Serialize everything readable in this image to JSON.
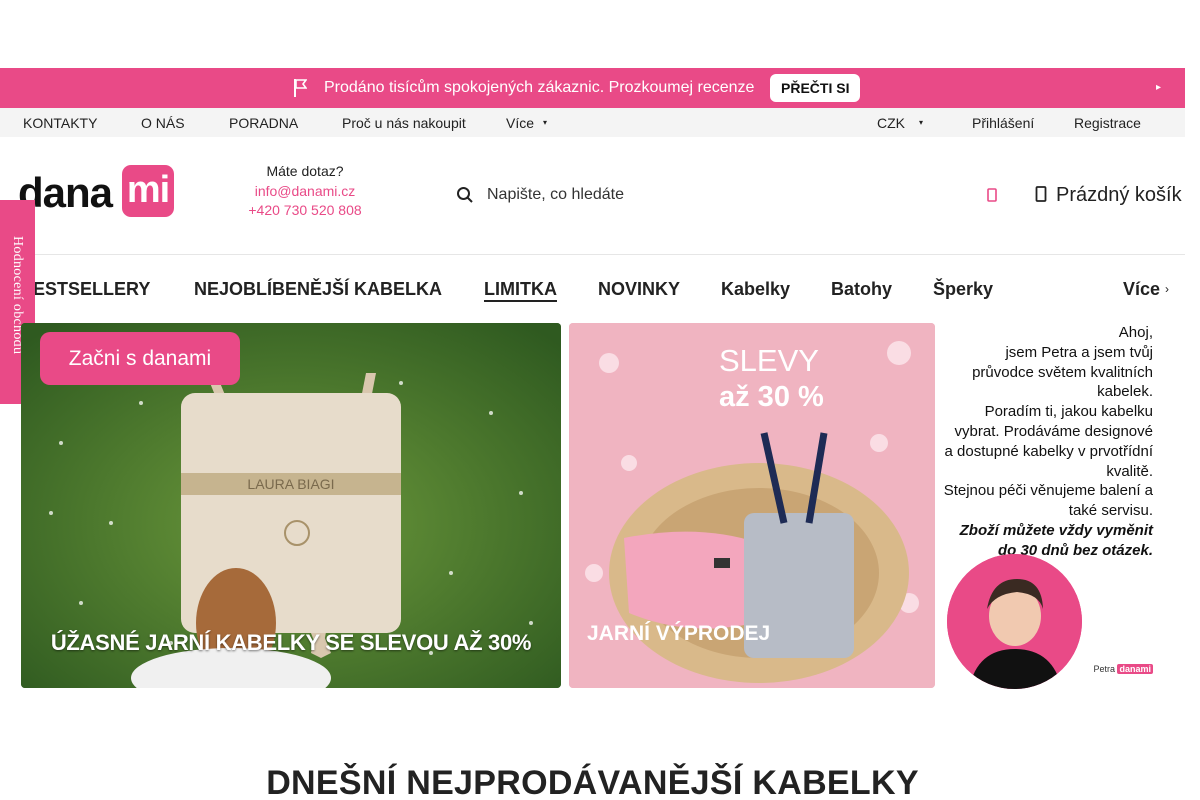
{
  "promo": {
    "text": "Prodáno tisícům spokojených zákaznic. Prozkoumej recenze",
    "cta": "PŘEČTI SI",
    "flag_icon": "flag-icon",
    "close_icon": "close-icon"
  },
  "topnav": {
    "left": [
      "KONTAKTY",
      "O NÁS",
      "PORADNA",
      "Proč u nás nakoupit",
      "Více"
    ],
    "currency": "CZK",
    "login": "Přihlášení",
    "register": "Registrace"
  },
  "header": {
    "logo_word": "dana",
    "logo_box": "mi",
    "contact_question": "Máte dotaz?",
    "email": "info@danami.cz",
    "phone": "+420 730 520 808",
    "search_placeholder": "Napište, co hledáte",
    "cart_label": "Prázdný košík"
  },
  "mainnav": {
    "items": [
      "BESTSELLERY",
      "NEJOBLÍBENĚJŠÍ KABELKA",
      "LIMITKA",
      "NOVINKY",
      "Kabelky",
      "Batohy",
      "Šperky"
    ],
    "more": "Více",
    "active": "LIMITKA"
  },
  "sidetab": "Hodnocení obchodu",
  "banners": {
    "b1_button": "Začni s danami",
    "b1_caption": "ÚŽASNÉ JARNÍ KABELKY SE SLEVOU AŽ 30%",
    "b2_title": "SLEVY",
    "b2_sub": "až 30 %",
    "b2_caption": "JARNÍ VÝPRODEJ",
    "b3_lines": [
      "Ahoj,",
      "jsem Petra a jsem tvůj",
      "průvodce světem kvalitních kabelek.",
      "Poradím ti, jakou kabelku vybrat. Prodáváme designové a dostupné kabelky v prvotřídní kvalitě.",
      "Stejnou péči věnujeme balení a také servisu.",
      "Zboží můžete vždy vyměnit do 30 dnů bez otázek."
    ],
    "b3_sign": "Petra",
    "b3_sign_brand": "danami"
  },
  "section_title": "DNEŠNÍ NEJPRODÁVANĚJŠÍ KABELKY",
  "colors": {
    "accent": "#e94a87"
  }
}
